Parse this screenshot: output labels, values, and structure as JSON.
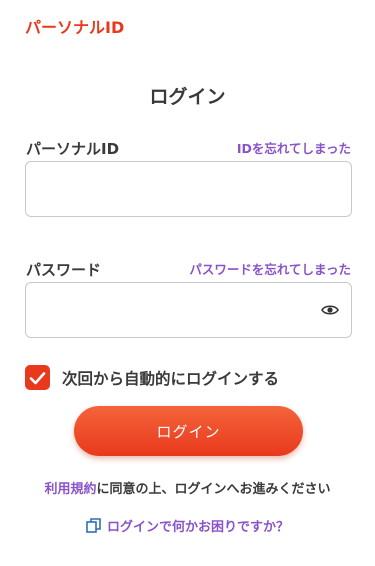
{
  "header": {
    "brand": "パーソナルID"
  },
  "page": {
    "title": "ログイン"
  },
  "id_field": {
    "label": "パーソナルID",
    "forgot_link": "IDを忘れてしまった",
    "value": "",
    "placeholder": ""
  },
  "password_field": {
    "label": "パスワード",
    "forgot_link": "パスワードを忘れてしまった",
    "value": "",
    "placeholder": "",
    "toggle_icon": "eye-icon"
  },
  "auto_login": {
    "label": "次回から自動的にログインする",
    "checked": true
  },
  "login_button": {
    "label": "ログイン"
  },
  "terms": {
    "link": "利用規約",
    "text": "に同意の上、ログインへお進みください"
  },
  "help": {
    "label": "ログインで何かお困りですか？",
    "icon": "copy-icon"
  },
  "colors": {
    "brand": "#e8391d",
    "link": "#8a54c9",
    "text": "#3a3a3a"
  }
}
